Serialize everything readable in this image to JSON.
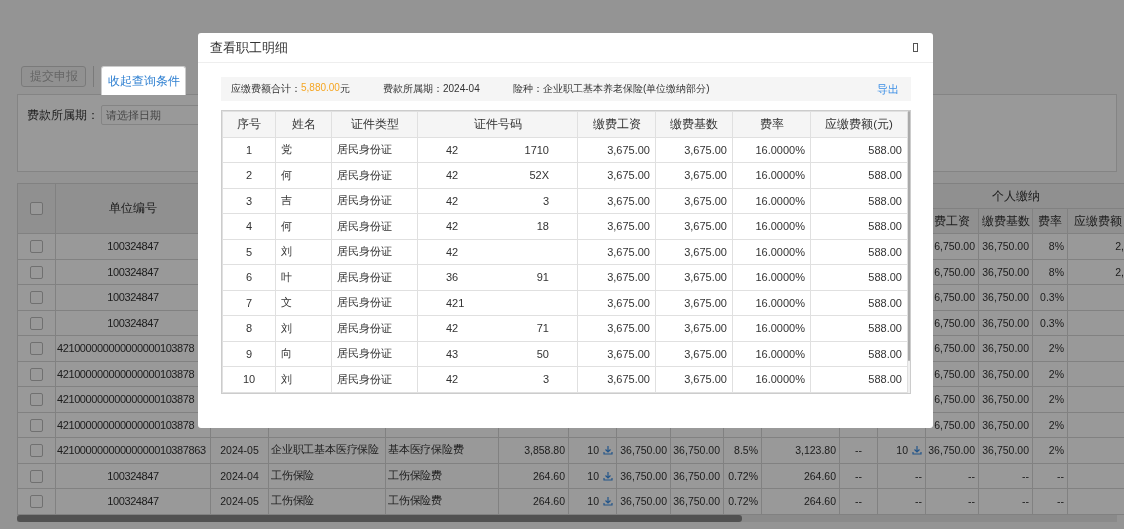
{
  "toolbar": {
    "buttons": [
      {
        "label": "提交申报",
        "disabled": true
      }
    ],
    "tabs": [
      {
        "label": "收起查询条件",
        "selected": true
      }
    ]
  },
  "filter": {
    "label": "费款所属期：",
    "placeholder": "请选择日期"
  },
  "table": {
    "select_all_checked": false,
    "unit_header": "单位编号",
    "group_header": "个人缴纳",
    "personal_headers": [
      "费工资",
      "缴费基数",
      "费率",
      "应缴费额"
    ],
    "rows": [
      {
        "kind": "partial",
        "checked": false,
        "unit_no": "100324847",
        "personal": [
          "6,750.00",
          "36,750.00",
          "8%",
          "2,"
        ]
      },
      {
        "kind": "partial",
        "checked": false,
        "unit_no": "100324847",
        "personal": [
          "6,750.00",
          "36,750.00",
          "8%",
          "2,"
        ]
      },
      {
        "kind": "partial",
        "checked": false,
        "unit_no": "100324847",
        "personal": [
          "6,750.00",
          "36,750.00",
          "0.3%"
        ]
      },
      {
        "kind": "partial",
        "checked": false,
        "unit_no": "100324847",
        "personal": [
          "6,750.00",
          "36,750.00",
          "0.3%"
        ]
      },
      {
        "kind": "partial",
        "checked": false,
        "unit_no": "421000000000000000103878",
        "personal": [
          "6,750.00",
          "36,750.00",
          "2%"
        ]
      },
      {
        "kind": "partial",
        "checked": false,
        "unit_no": "421000000000000000103878",
        "personal": [
          "6,750.00",
          "36,750.00",
          "2%"
        ]
      },
      {
        "kind": "partial",
        "checked": false,
        "unit_no": "421000000000000000103878",
        "personal": [
          "6,750.00",
          "36,750.00",
          "2%"
        ]
      },
      {
        "kind": "partial",
        "checked": false,
        "unit_no": "421000000000000000103878",
        "personal": [
          "6,750.00",
          "36,750.00",
          "2%"
        ]
      },
      {
        "kind": "full",
        "checked": false,
        "unit_no": "42100000000000000010387863",
        "cells": [
          "2024-05",
          "企业职工基本医疗保险",
          "基本医疗保险费",
          "3,858.80",
          {
            "text": "10",
            "kind": "download"
          },
          "36,750.00",
          "36,750.00",
          "8.5%",
          "3,123.80",
          "--",
          {
            "text": "10",
            "kind": "download"
          },
          "36,750.00",
          "36,750.00",
          "2%"
        ]
      },
      {
        "kind": "full",
        "checked": false,
        "unit_no": "100324847",
        "cells": [
          "2024-04",
          "工伤保险",
          "工伤保险费",
          "264.60",
          {
            "text": "10",
            "kind": "download"
          },
          "36,750.00",
          "36,750.00",
          "0.72%",
          "264.60",
          "--",
          "--",
          "--",
          "--",
          "--"
        ]
      },
      {
        "kind": "full",
        "checked": false,
        "unit_no": "100324847",
        "cells": [
          "2024-05",
          "工伤保险",
          "工伤保险费",
          "264.60",
          {
            "text": "10",
            "kind": "download"
          },
          "36,750.00",
          "36,750.00",
          "0.72%",
          "264.60",
          "--",
          "--",
          "--",
          "--",
          "--"
        ]
      }
    ]
  },
  "dialog": {
    "title": "查看职工明细",
    "summary": {
      "total_label": "应缴费额合计：",
      "total_amount": "5,880.00",
      "total_unit": "元",
      "period": "费款所属期：2024-04",
      "insurance": "险种：企业职工基本养老保险(单位缴纳部分)",
      "export": "导出"
    },
    "columns": [
      "序号",
      "姓名",
      "证件类型",
      "证件号码",
      "缴费工资",
      "缴费基数",
      "费率",
      "应缴费额(元)"
    ],
    "rows": [
      {
        "no": "1",
        "name": "党",
        "id_type": "居民身份证",
        "id_prefix": "42",
        "id_suffix": "1710",
        "wage": "3,675.00",
        "base": "3,675.00",
        "rate": "16.0000%",
        "due": "588.00"
      },
      {
        "no": "2",
        "name": "何",
        "id_type": "居民身份证",
        "id_prefix": "42",
        "id_suffix": "52X",
        "wage": "3,675.00",
        "base": "3,675.00",
        "rate": "16.0000%",
        "due": "588.00"
      },
      {
        "no": "3",
        "name": "吉",
        "id_type": "居民身份证",
        "id_prefix": "42",
        "id_suffix": "3",
        "wage": "3,675.00",
        "base": "3,675.00",
        "rate": "16.0000%",
        "due": "588.00"
      },
      {
        "no": "4",
        "name": "何",
        "id_type": "居民身份证",
        "id_prefix": "42",
        "id_suffix": "18",
        "wage": "3,675.00",
        "base": "3,675.00",
        "rate": "16.0000%",
        "due": "588.00"
      },
      {
        "no": "5",
        "name": "刘",
        "id_type": "居民身份证",
        "id_prefix": "42",
        "wage": "3,675.00",
        "base": "3,675.00",
        "rate": "16.0000%",
        "due": "588.00"
      },
      {
        "no": "6",
        "name": "叶",
        "id_type": "居民身份证",
        "id_prefix": "36",
        "id_suffix": "91",
        "wage": "3,675.00",
        "base": "3,675.00",
        "rate": "16.0000%",
        "due": "588.00"
      },
      {
        "no": "7",
        "name": "文",
        "id_type": "居民身份证",
        "id_prefix": "421",
        "wage": "3,675.00",
        "base": "3,675.00",
        "rate": "16.0000%",
        "due": "588.00"
      },
      {
        "no": "8",
        "name": "刘",
        "id_type": "居民身份证",
        "id_prefix": "42",
        "id_suffix": "71",
        "wage": "3,675.00",
        "base": "3,675.00",
        "rate": "16.0000%",
        "due": "588.00"
      },
      {
        "no": "9",
        "name": "向",
        "id_type": "居民身份证",
        "id_prefix": "43",
        "id_suffix": "50",
        "wage": "3,675.00",
        "base": "3,675.00",
        "rate": "16.0000%",
        "due": "588.00"
      },
      {
        "no": "10",
        "name": "刘",
        "id_type": "居民身份证",
        "id_prefix": "42",
        "id_suffix": "3",
        "wage": "3,675.00",
        "base": "3,675.00",
        "rate": "16.0000%",
        "due": "588.00"
      }
    ]
  }
}
